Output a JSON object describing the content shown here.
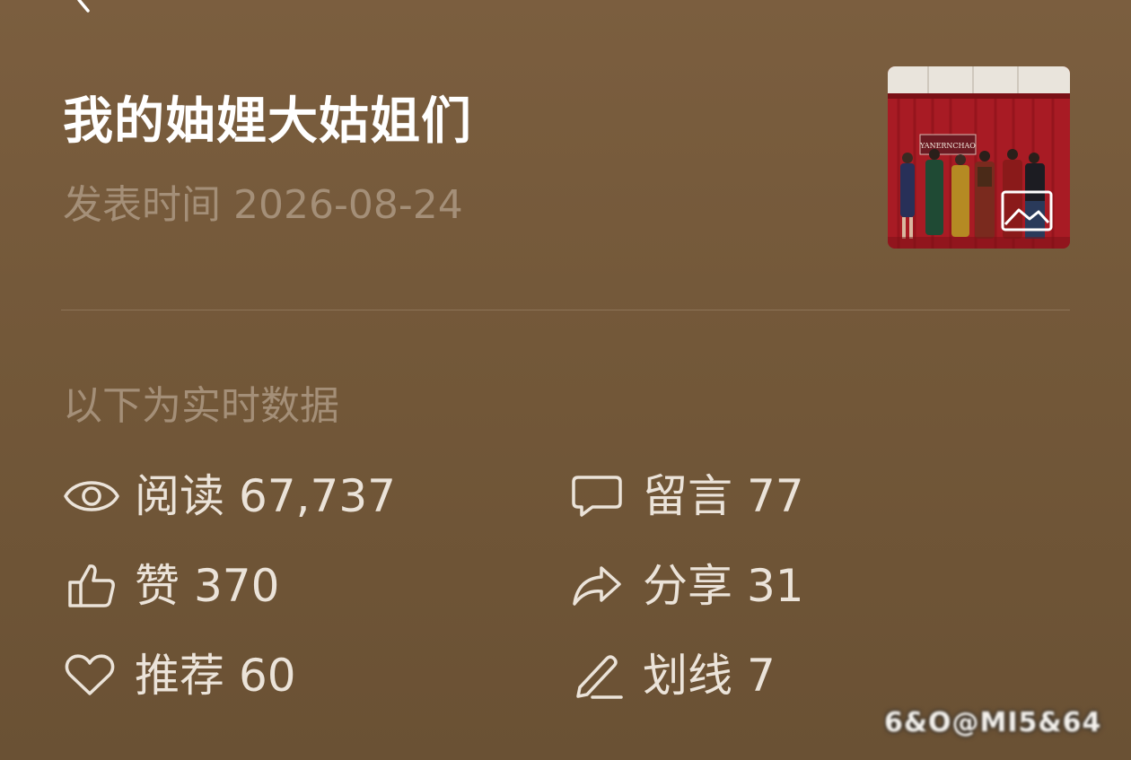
{
  "header": {
    "back_icon": "chevron-left-icon"
  },
  "article": {
    "title": "我的妯娌大姑姐们",
    "publish_label": "发表时间",
    "publish_date": "2026-08-24",
    "thumbnail_icon": "image-icon",
    "thumbnail_sign_text": "YANERNCHAO"
  },
  "stats": {
    "section_label": "以下为实时数据",
    "items": [
      {
        "icon": "eye-icon",
        "label": "阅读",
        "value": "67,737"
      },
      {
        "icon": "comment-icon",
        "label": "留言",
        "value": "77"
      },
      {
        "icon": "thumbs-up-icon",
        "label": "赞",
        "value": "370"
      },
      {
        "icon": "share-icon",
        "label": "分享",
        "value": "31"
      },
      {
        "icon": "heart-icon",
        "label": "推荐",
        "value": "60"
      },
      {
        "icon": "pencil-icon",
        "label": "划线",
        "value": "7"
      }
    ]
  },
  "watermark": {
    "text": "6&O@MI5&64"
  },
  "colors": {
    "background_top": "#7b5e3f",
    "background_bottom": "#6a5134",
    "title": "#ffffff",
    "muted": "#a48f78",
    "stat_text": "#ebe3d9"
  }
}
